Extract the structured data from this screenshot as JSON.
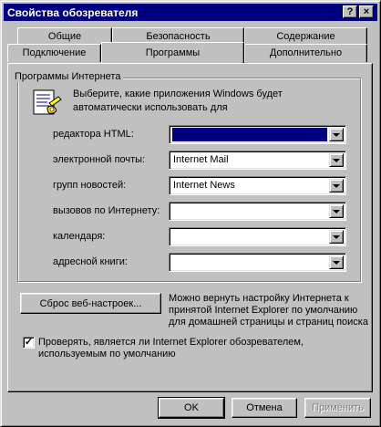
{
  "window": {
    "title": "Свойства обозревателя",
    "help_glyph": "?",
    "close_glyph": "×"
  },
  "tabs": {
    "row1": [
      "Общие",
      "Безопасность",
      "Содержание"
    ],
    "row2": [
      "Подключение",
      "Программы",
      "Дополнительно"
    ],
    "active": "Программы"
  },
  "group": {
    "title": "Программы Интернета",
    "description_line1": "Выберите, какие приложения Windows будет",
    "description_line2": "автоматически использовать для"
  },
  "programs": [
    {
      "label": "редактора HTML:",
      "value": "",
      "selected": true
    },
    {
      "label": "электронной почты:",
      "value": "Internet Mail",
      "selected": false
    },
    {
      "label": "групп новостей:",
      "value": "Internet News",
      "selected": false
    },
    {
      "label": "вызовов по Интернету:",
      "value": "",
      "selected": false
    },
    {
      "label": "календаря:",
      "value": "",
      "selected": false
    },
    {
      "label": "адресной книги:",
      "value": "",
      "selected": false
    }
  ],
  "reset": {
    "button_label": "Сброс веб-настроек...",
    "note_line1": "Можно вернуть настройку Интернета к",
    "note_line2": "принятой Internet Explorer по умолчанию",
    "note_line3": "для домашней страницы и страниц поиска"
  },
  "default_check": {
    "checked": true,
    "mark": "✓",
    "label_line1": "Проверять, является ли Internet Explorer обозревателем,",
    "label_line2": "используемым по умолчанию"
  },
  "buttons": {
    "ok": "OK",
    "cancel": "Отмена",
    "apply": "Применить"
  }
}
